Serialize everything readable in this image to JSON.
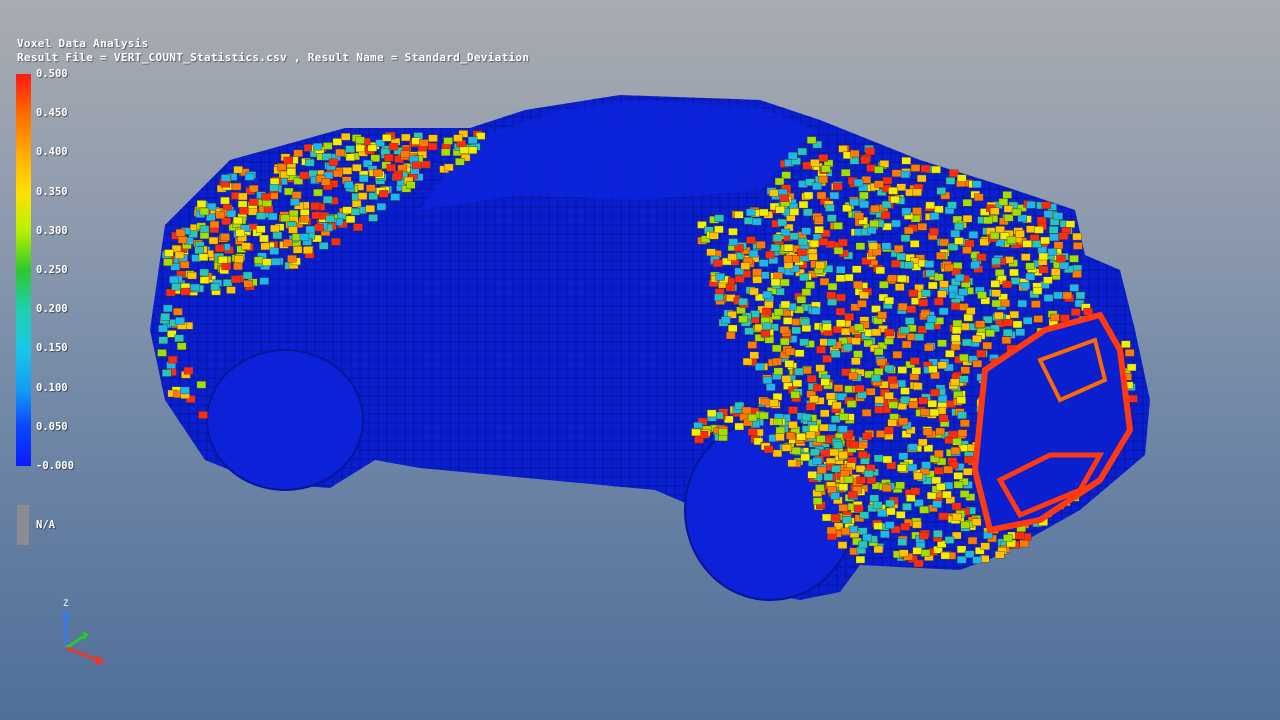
{
  "viewer": {
    "title": "Voxel Data Analysis",
    "result_line": "Result File = VERT_COUNT_Statistics.csv , Result Name = Standard_Deviation"
  },
  "legend": {
    "ticks": [
      "0.500",
      "0.450",
      "0.400",
      "0.350",
      "0.300",
      "0.250",
      "0.200",
      "0.150",
      "0.100",
      "0.050",
      "-0.000"
    ],
    "colors": [
      "#ff1a10",
      "#ff6a00",
      "#ffaa00",
      "#ffe000",
      "#b8f000",
      "#2ec82e",
      "#1ed0b0",
      "#19c8e6",
      "#14a0f5",
      "#0a46ff",
      "#0a1cff"
    ],
    "na_label": "N/A",
    "na_color": "#8a8c92"
  },
  "axis_triad": {
    "z_label": "Z",
    "colors": {
      "z": "#3a7ae6",
      "y": "#2ec82e",
      "x": "#e63a2a"
    }
  },
  "model": {
    "base_color": "#0a1fcf",
    "highlight_colors": [
      "#ff2a10",
      "#ff7a00",
      "#ffc400",
      "#f0f000",
      "#9fe000",
      "#22c8c0",
      "#19b8f0"
    ]
  }
}
